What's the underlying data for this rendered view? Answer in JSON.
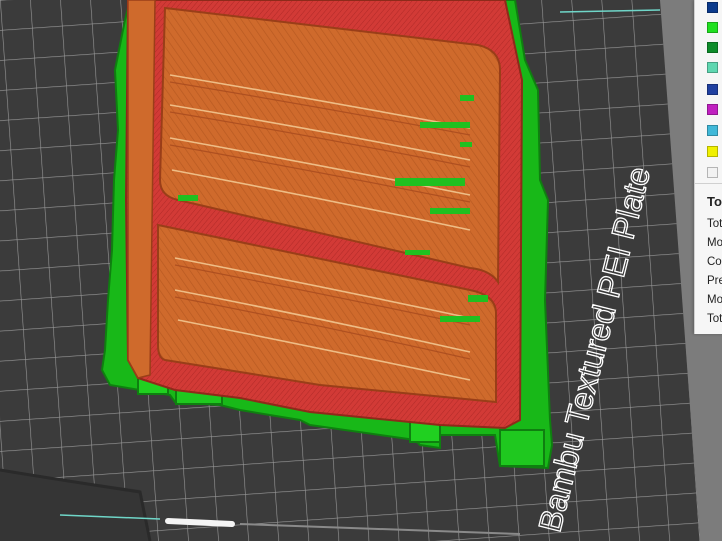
{
  "plate": {
    "label": "Bambu Textured PEI Plate"
  },
  "legend": {
    "swatches": [
      {
        "name": "legend-swatch-dark-blue",
        "color": "#0a3a8c"
      },
      {
        "name": "legend-swatch-bright-green",
        "color": "#20e020"
      },
      {
        "name": "legend-swatch-dark-green",
        "color": "#0d8c2a"
      },
      {
        "name": "legend-swatch-teal",
        "color": "#5ed6b0"
      },
      {
        "name": "legend-swatch-navy",
        "color": "#2040a0"
      },
      {
        "name": "legend-swatch-magenta",
        "color": "#c020c0"
      },
      {
        "name": "legend-swatch-cyan",
        "color": "#40b8d8"
      },
      {
        "name": "legend-swatch-yellow",
        "color": "#f0f000"
      },
      {
        "name": "legend-swatch-white",
        "color": "#f2f2f2"
      }
    ],
    "stats_header": "To",
    "stats": [
      "Tot",
      "Mo",
      "Co",
      "Pre",
      "Mo",
      "Tot"
    ]
  },
  "colors": {
    "plate": "#3b3b3b",
    "grid": "#9c9c9c",
    "support": "#18b818",
    "outer_wall": "#d23a36",
    "infill": "#cf6a2c",
    "highlight": "#f0b070"
  }
}
